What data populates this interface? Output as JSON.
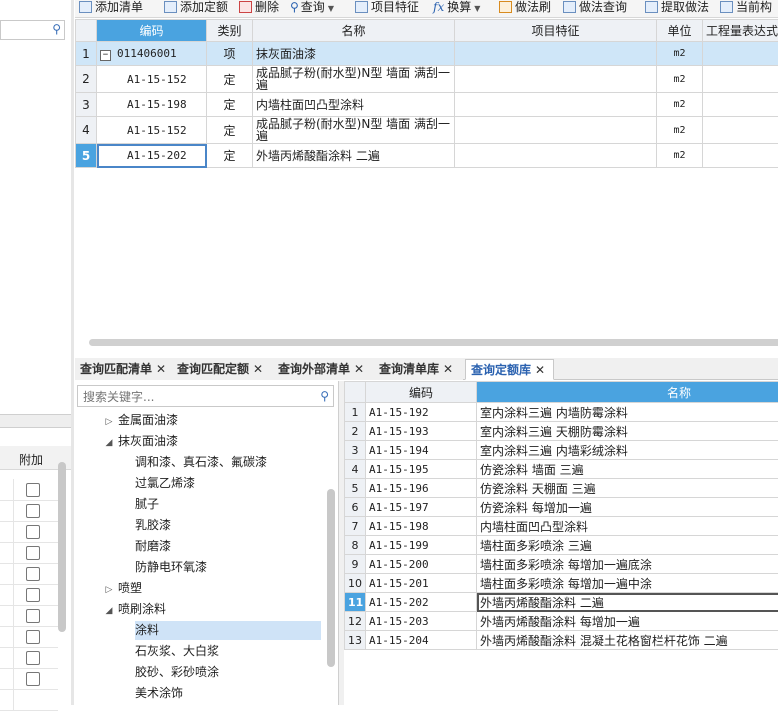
{
  "toolbar": {
    "items": [
      {
        "label": "添加清单",
        "icon": "add-list-icon"
      },
      {
        "label": "添加定额",
        "icon": "add-quota-icon"
      },
      {
        "label": "删除",
        "icon": "delete-icon"
      },
      {
        "label": "查询",
        "icon": "search-icon"
      },
      {
        "label": "项目特征",
        "icon": "feature-icon"
      },
      {
        "label": "换算",
        "icon": "fx-icon"
      },
      {
        "label": "做法刷",
        "icon": "brush-icon"
      },
      {
        "label": "做法查询",
        "icon": "method-search-icon"
      },
      {
        "label": "提取做法",
        "icon": "extract-icon"
      },
      {
        "label": "当前构",
        "icon": "current-component-icon"
      }
    ]
  },
  "upper_grid": {
    "columns": [
      "编码",
      "类别",
      "名称",
      "项目特征",
      "单位",
      "工程量表达式"
    ],
    "rows": [
      {
        "n": "1",
        "code": "011406001",
        "type": "项",
        "name": "抹灰面油漆",
        "unit": "m2"
      },
      {
        "n": "2",
        "code": "A1-15-152",
        "type": "定",
        "name": "成品腻子粉(耐水型)N型 墙面 满刮一遍",
        "unit": "m2"
      },
      {
        "n": "3",
        "code": "A1-15-198",
        "type": "定",
        "name": "内墙柱面凹凸型涂料",
        "unit": "m2"
      },
      {
        "n": "4",
        "code": "A1-15-152",
        "type": "定",
        "name": "成品腻子粉(耐水型)N型 墙面 满刮一遍",
        "unit": "m2"
      },
      {
        "n": "5",
        "code": "A1-15-202",
        "type": "定",
        "name": "外墙丙烯酸酯涂料 二遍",
        "unit": "m2"
      }
    ]
  },
  "left_panel": {
    "col_label": "附加"
  },
  "tabs": [
    {
      "label": "查询匹配清单",
      "close": "✕"
    },
    {
      "label": "查询匹配定额",
      "close": "✕"
    },
    {
      "label": "查询外部清单",
      "close": "✕"
    },
    {
      "label": "查询清单库",
      "close": "✕"
    },
    {
      "label": "查询定额库",
      "close": "✕"
    }
  ],
  "tree": {
    "search_placeholder": "搜索关键字...",
    "nodes": [
      {
        "label": "金属面油漆",
        "toggle": "▷"
      },
      {
        "label": "抹灰面油漆",
        "toggle": "◢"
      },
      {
        "label": "调和漆、真石漆、氟碳漆",
        "toggle": ""
      },
      {
        "label": "过氯乙烯漆",
        "toggle": ""
      },
      {
        "label": "腻子",
        "toggle": ""
      },
      {
        "label": "乳胶漆",
        "toggle": ""
      },
      {
        "label": "耐磨漆",
        "toggle": ""
      },
      {
        "label": "防静电环氧漆",
        "toggle": ""
      },
      {
        "label": "喷塑",
        "toggle": "▷"
      },
      {
        "label": "喷刷涂料",
        "toggle": "◢"
      },
      {
        "label": "涂料",
        "toggle": ""
      },
      {
        "label": "石灰浆、大白浆",
        "toggle": ""
      },
      {
        "label": "胶砂、彩砂喷涂",
        "toggle": ""
      },
      {
        "label": "美术涂饰",
        "toggle": ""
      }
    ]
  },
  "quota_grid": {
    "columns": [
      "编码",
      "名称"
    ],
    "rows": [
      {
        "n": "1",
        "code": "A1-15-192",
        "name": "室内涂料三遍 内墙防霉涂料"
      },
      {
        "n": "2",
        "code": "A1-15-193",
        "name": "室内涂料三遍 天棚防霉涂料"
      },
      {
        "n": "3",
        "code": "A1-15-194",
        "name": "室内涂料三遍 内墙彩绒涂料"
      },
      {
        "n": "4",
        "code": "A1-15-195",
        "name": "仿瓷涂料 墙面 三遍"
      },
      {
        "n": "5",
        "code": "A1-15-196",
        "name": "仿瓷涂料 天棚面 三遍"
      },
      {
        "n": "6",
        "code": "A1-15-197",
        "name": "仿瓷涂料 每增加一遍"
      },
      {
        "n": "7",
        "code": "A1-15-198",
        "name": "内墙柱面凹凸型涂料"
      },
      {
        "n": "8",
        "code": "A1-15-199",
        "name": "墙柱面多彩喷涂 三遍"
      },
      {
        "n": "9",
        "code": "A1-15-200",
        "name": "墙柱面多彩喷涂 每增加一遍底涂"
      },
      {
        "n": "10",
        "code": "A1-15-201",
        "name": "墙柱面多彩喷涂 每增加一遍中涂"
      },
      {
        "n": "11",
        "code": "A1-15-202",
        "name": "外墙丙烯酸酯涂料 二遍"
      },
      {
        "n": "12",
        "code": "A1-15-203",
        "name": "外墙丙烯酸酯涂料 每增加一遍"
      },
      {
        "n": "13",
        "code": "A1-15-204",
        "name": "外墙丙烯酸酯涂料 混凝土花格窗栏杆花饰 二遍"
      }
    ]
  },
  "colors": {
    "accent": "#4aa3e0",
    "selected_row": "#cfe6f8",
    "tab_active_text": "#2b62b0"
  }
}
